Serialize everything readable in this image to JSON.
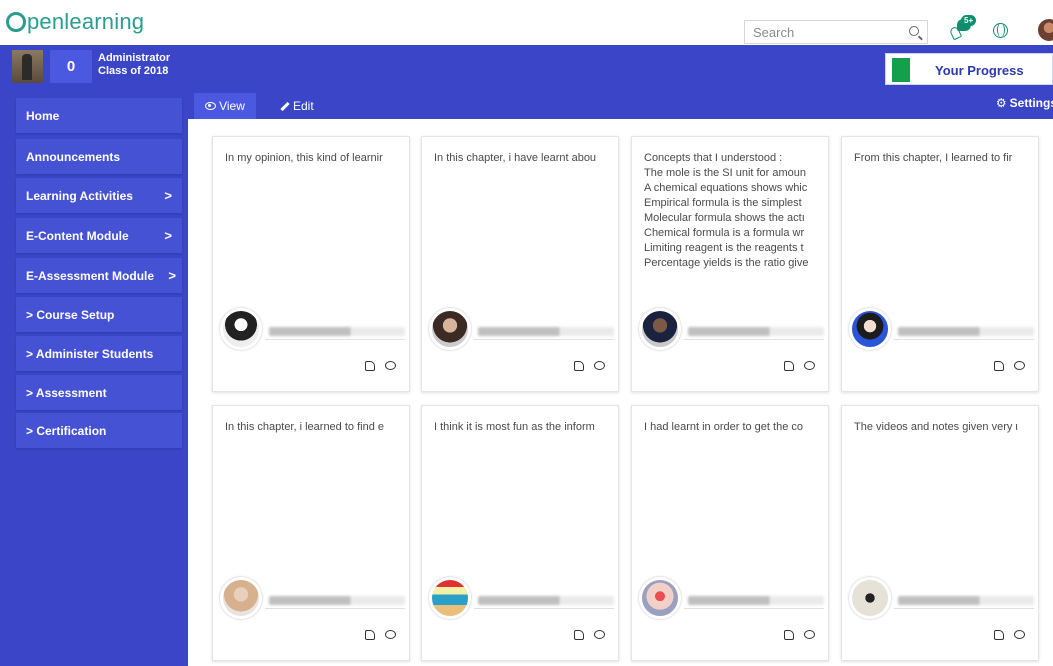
{
  "app": {
    "logo_text": "penlearning"
  },
  "search": {
    "placeholder": "Search"
  },
  "notifications": {
    "badge": "5+"
  },
  "profile": {
    "points": "0",
    "role_line1": "Administrator",
    "role_line2": "Class of 2018"
  },
  "progress_button": {
    "label": "Your Progress",
    "color": "#13a04a"
  },
  "sidebar": {
    "items": [
      {
        "label": "Home",
        "chevron": ""
      },
      {
        "label": "Announcements",
        "chevron": ""
      },
      {
        "label": "Learning Activities",
        "chevron": ">"
      },
      {
        "label": "E-Content Module",
        "chevron": ">"
      },
      {
        "label": "E-Assessment Module",
        "chevron": ">"
      },
      {
        "label": "> Course Setup",
        "chevron": ""
      },
      {
        "label": "> Administer Students",
        "chevron": ""
      },
      {
        "label": "> Assessment",
        "chevron": ""
      },
      {
        "label": "> Certification",
        "chevron": ""
      }
    ]
  },
  "toolbar": {
    "view_label": "View",
    "edit_label": "Edit",
    "settings_label": "Settings"
  },
  "cards": [
    {
      "lines": [
        "In my opinion, this kind of learnir"
      ]
    },
    {
      "lines": [
        "In this chapter, i have learnt abou"
      ]
    },
    {
      "lines": [
        "Concepts that I understood :",
        "The mole is the SI unit for amoun",
        "A chemical equations shows whic",
        "Empirical formula is the simplest",
        "Molecular formula shows the actı",
        "Chemical formula is a formula wr",
        "Limiting reagent is the reagents t",
        "Percentage yields is the ratio give"
      ]
    },
    {
      "lines": [
        "From this chapter, I learned to fir"
      ]
    },
    {
      "lines": [
        "In this chapter, i learned to find e"
      ]
    },
    {
      "lines": [
        "I think it is most fun as the inform"
      ]
    },
    {
      "lines": [
        "I had learnt in order to get the co"
      ]
    },
    {
      "lines": [
        "The videos and notes given very ι"
      ]
    }
  ],
  "colors": {
    "brand": "#2a9d8f",
    "primary": "#3a45c8",
    "accent": "#4b58e0"
  }
}
